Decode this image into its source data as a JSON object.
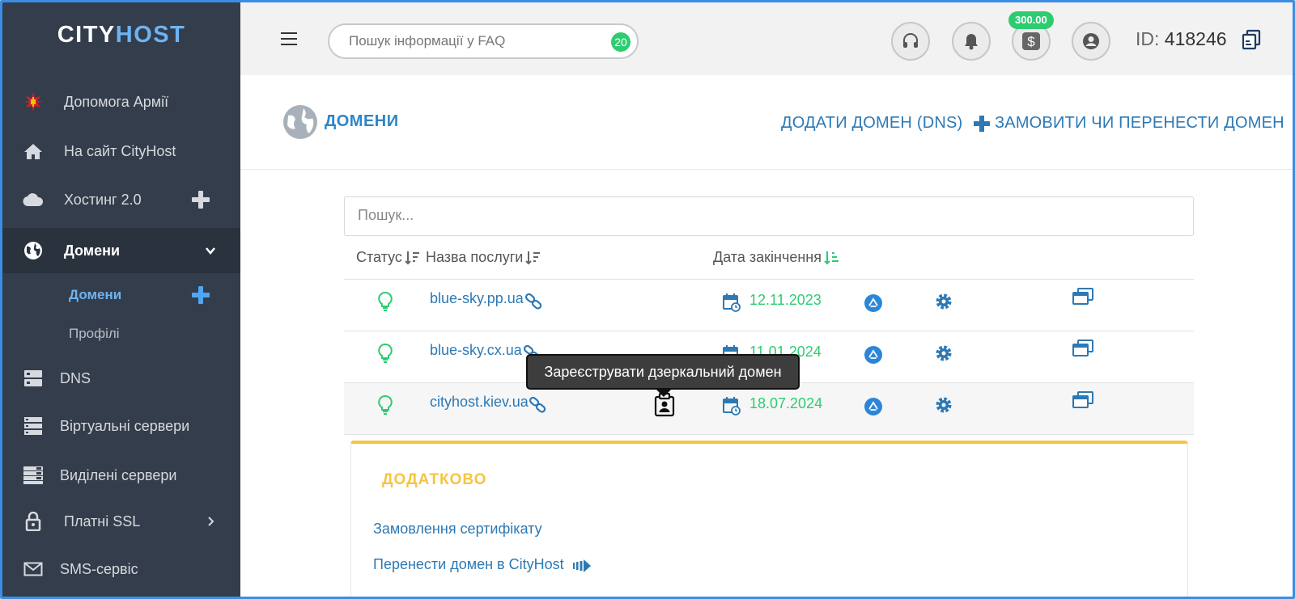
{
  "brand": {
    "city": "CITY",
    "host": "HOST"
  },
  "sidebar": {
    "items": [
      {
        "label": "Допомога Армії",
        "icon": "army-emblem-icon"
      },
      {
        "label": "На сайт CityHost",
        "icon": "home-icon"
      },
      {
        "label": "Хостинг 2.0",
        "icon": "cloud-icon"
      },
      {
        "label": "Домени",
        "icon": "globe-icon"
      },
      {
        "label": "DNS",
        "icon": "dns-icon"
      },
      {
        "label": "Віртуальні сервери",
        "icon": "servers-icon"
      },
      {
        "label": "Виділені сервери",
        "icon": "dedicated-servers-icon"
      },
      {
        "label": "Платні SSL",
        "icon": "lock-icon"
      },
      {
        "label": "SMS-сервіс",
        "icon": "mail-icon"
      }
    ],
    "subitems": [
      {
        "label": "Домени"
      },
      {
        "label": "Профілі"
      }
    ]
  },
  "topbar": {
    "faq_placeholder": "Пошук інформації у FAQ",
    "faq_badge": "20",
    "balance": "300.00",
    "id_label": "ID:",
    "id_value": "418246"
  },
  "page": {
    "title": "ДОМЕНИ",
    "add_dns": "ДОДАТИ ДОМЕН (DNS)",
    "order_transfer": "ЗАМОВИТИ ЧИ ПЕРЕНЕСТИ ДОМЕН"
  },
  "table": {
    "search_placeholder": "Пошук...",
    "columns": {
      "status": "Статус",
      "name": "Назва послуги",
      "expiry": "Дата закінчення"
    },
    "rows": [
      {
        "domain": "blue-sky.pp.ua",
        "date": "12.11.2023"
      },
      {
        "domain": "blue-sky.cx.ua",
        "date": "11.01.2024"
      },
      {
        "domain": "cityhost.kiev.ua",
        "date": "18.07.2024"
      }
    ]
  },
  "tooltip": "Зареєструвати дзеркальний домен",
  "extra": {
    "title": "ДОДАТКОВО",
    "links": [
      "Замовлення сертифікату",
      "Перенести домен в CityHost"
    ]
  },
  "colors": {
    "accent": "#2c79b5",
    "green": "#2ecc71",
    "sidebar": "#343d4b",
    "gold": "#f6c343"
  }
}
